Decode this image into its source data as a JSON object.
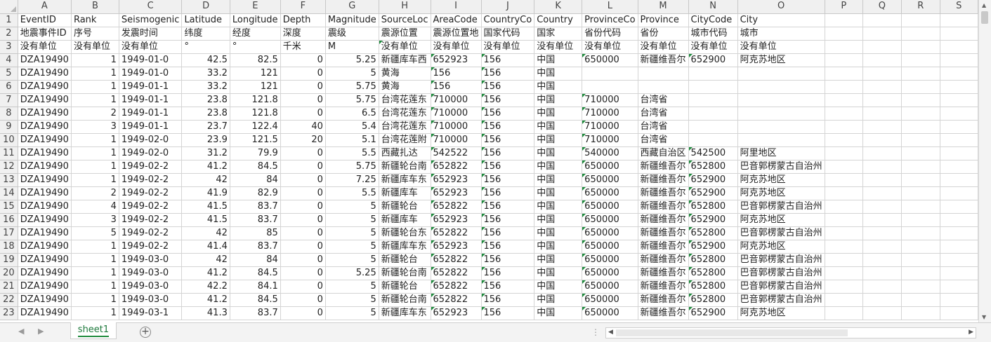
{
  "columns": [
    "A",
    "B",
    "C",
    "D",
    "E",
    "F",
    "G",
    "H",
    "I",
    "J",
    "K",
    "L",
    "M",
    "N",
    "O",
    "P",
    "Q",
    "R",
    "S"
  ],
  "rows": [
    [
      "EventID",
      "Rank",
      "Seismogenic",
      "Latitude",
      "Longitude",
      "Depth",
      "Magnitude",
      "SourceLoc",
      "AreaCode",
      "CountryCo",
      "Country",
      "ProvinceCo",
      "Province",
      "CityCode",
      "City",
      "",
      "",
      "",
      ""
    ],
    [
      "地震事件ID",
      "序号",
      "发震时间",
      "纬度",
      "经度",
      "深度",
      "震级",
      "震源位置",
      "震源位置地",
      "国家代码",
      "国家",
      "省份代码",
      "省份",
      "城市代码",
      "城市",
      "",
      "",
      "",
      ""
    ],
    [
      "没有单位",
      "没有单位",
      "没有单位",
      "°",
      "°",
      "千米",
      "M",
      "没有单位",
      "没有单位",
      "没有单位",
      "没有单位",
      "没有单位",
      "没有单位",
      "没有单位",
      "没有单位",
      "",
      "",
      "",
      ""
    ],
    [
      "DZA19490",
      "1",
      "1949-01-0",
      "42.5",
      "82.5",
      "0",
      "5.25",
      "新疆库车西",
      "652923",
      "156",
      "中国",
      "650000",
      "新疆维吾尔",
      "652900",
      "阿克苏地区",
      "",
      "",
      "",
      ""
    ],
    [
      "DZA19490",
      "1",
      "1949-01-0",
      "33.2",
      "121",
      "0",
      "5",
      "黄海",
      "156",
      "156",
      "中国",
      "",
      "",
      "",
      "",
      "",
      "",
      "",
      ""
    ],
    [
      "DZA19490",
      "1",
      "1949-01-1",
      "33.2",
      "121",
      "0",
      "5.75",
      "黄海",
      "156",
      "156",
      "中国",
      "",
      "",
      "",
      "",
      "",
      "",
      "",
      ""
    ],
    [
      "DZA19490",
      "1",
      "1949-01-1",
      "23.8",
      "121.8",
      "0",
      "5.75",
      "台湾花莲东",
      "710000",
      "156",
      "中国",
      "710000",
      "台湾省",
      "",
      "",
      "",
      "",
      "",
      ""
    ],
    [
      "DZA19490",
      "2",
      "1949-01-1",
      "23.8",
      "121.8",
      "0",
      "6.5",
      "台湾花莲东",
      "710000",
      "156",
      "中国",
      "710000",
      "台湾省",
      "",
      "",
      "",
      "",
      "",
      ""
    ],
    [
      "DZA19490",
      "3",
      "1949-01-1",
      "23.7",
      "122.4",
      "40",
      "5.4",
      "台湾花莲东",
      "710000",
      "156",
      "中国",
      "710000",
      "台湾省",
      "",
      "",
      "",
      "",
      "",
      ""
    ],
    [
      "DZA19490",
      "1",
      "1949-02-0",
      "23.9",
      "121.5",
      "20",
      "5.1",
      "台湾花莲附",
      "710000",
      "156",
      "中国",
      "710000",
      "台湾省",
      "",
      "",
      "",
      "",
      "",
      ""
    ],
    [
      "DZA19490",
      "1",
      "1949-02-0",
      "31.2",
      "79.9",
      "0",
      "5.5",
      "西藏扎达",
      "542522",
      "156",
      "中国",
      "540000",
      "西藏自治区",
      "542500",
      "阿里地区",
      "",
      "",
      "",
      ""
    ],
    [
      "DZA19490",
      "1",
      "1949-02-2",
      "41.2",
      "84.5",
      "0",
      "5.75",
      "新疆轮台南",
      "652822",
      "156",
      "中国",
      "650000",
      "新疆维吾尔",
      "652800",
      "巴音郭楞蒙古自治州",
      "",
      "",
      "",
      ""
    ],
    [
      "DZA19490",
      "1",
      "1949-02-2",
      "42",
      "84",
      "0",
      "7.25",
      "新疆库车东",
      "652923",
      "156",
      "中国",
      "650000",
      "新疆维吾尔",
      "652900",
      "阿克苏地区",
      "",
      "",
      "",
      ""
    ],
    [
      "DZA19490",
      "2",
      "1949-02-2",
      "41.9",
      "82.9",
      "0",
      "5.5",
      "新疆库车",
      "652923",
      "156",
      "中国",
      "650000",
      "新疆维吾尔",
      "652900",
      "阿克苏地区",
      "",
      "",
      "",
      ""
    ],
    [
      "DZA19490",
      "4",
      "1949-02-2",
      "41.5",
      "83.7",
      "0",
      "5",
      "新疆轮台",
      "652822",
      "156",
      "中国",
      "650000",
      "新疆维吾尔",
      "652800",
      "巴音郭楞蒙古自治州",
      "",
      "",
      "",
      ""
    ],
    [
      "DZA19490",
      "3",
      "1949-02-2",
      "41.5",
      "83.7",
      "0",
      "5",
      "新疆库车",
      "652923",
      "156",
      "中国",
      "650000",
      "新疆维吾尔",
      "652900",
      "阿克苏地区",
      "",
      "",
      "",
      ""
    ],
    [
      "DZA19490",
      "5",
      "1949-02-2",
      "42",
      "85",
      "0",
      "5",
      "新疆轮台东",
      "652822",
      "156",
      "中国",
      "650000",
      "新疆维吾尔",
      "652800",
      "巴音郭楞蒙古自治州",
      "",
      "",
      "",
      ""
    ],
    [
      "DZA19490",
      "1",
      "1949-02-2",
      "41.4",
      "83.7",
      "0",
      "5",
      "新疆库车东",
      "652923",
      "156",
      "中国",
      "650000",
      "新疆维吾尔",
      "652900",
      "阿克苏地区",
      "",
      "",
      "",
      ""
    ],
    [
      "DZA19490",
      "1",
      "1949-03-0",
      "42",
      "84",
      "0",
      "5",
      "新疆轮台",
      "652822",
      "156",
      "中国",
      "650000",
      "新疆维吾尔",
      "652800",
      "巴音郭楞蒙古自治州",
      "",
      "",
      "",
      ""
    ],
    [
      "DZA19490",
      "1",
      "1949-03-0",
      "41.2",
      "84.5",
      "0",
      "5.25",
      "新疆轮台南",
      "652822",
      "156",
      "中国",
      "650000",
      "新疆维吾尔",
      "652800",
      "巴音郭楞蒙古自治州",
      "",
      "",
      "",
      ""
    ],
    [
      "DZA19490",
      "1",
      "1949-03-0",
      "42.2",
      "84.1",
      "0",
      "5",
      "新疆轮台",
      "652822",
      "156",
      "中国",
      "650000",
      "新疆维吾尔",
      "652800",
      "巴音郭楞蒙古自治州",
      "",
      "",
      "",
      ""
    ],
    [
      "DZA19490",
      "1",
      "1949-03-0",
      "41.2",
      "84.5",
      "0",
      "5",
      "新疆轮台南",
      "652822",
      "156",
      "中国",
      "650000",
      "新疆维吾尔",
      "652800",
      "巴音郭楞蒙古自治州",
      "",
      "",
      "",
      ""
    ],
    [
      "DZA19490",
      "1",
      "1949-03-1",
      "41.3",
      "83.7",
      "0",
      "5",
      "新疆库车东",
      "652923",
      "156",
      "中国",
      "650000",
      "新疆维吾尔",
      "652900",
      "阿克苏地区",
      "",
      "",
      "",
      ""
    ]
  ],
  "numeric_columns": [
    1,
    3,
    4,
    5,
    6
  ],
  "text_number_columns": [
    8,
    9,
    11,
    13
  ],
  "sheet_tabs": [
    "sheet1"
  ],
  "add_sheet_label": "+",
  "accent_color": "#1e8a3c",
  "icons": {
    "prev_sheet": "left-arrow-icon",
    "next_sheet": "right-arrow-icon",
    "add_sheet": "plus-circle-icon",
    "scroll_up": "triangle-up-icon",
    "scroll_down": "triangle-down-icon",
    "scroll_left": "triangle-left-icon",
    "scroll_right": "triangle-right-icon"
  }
}
